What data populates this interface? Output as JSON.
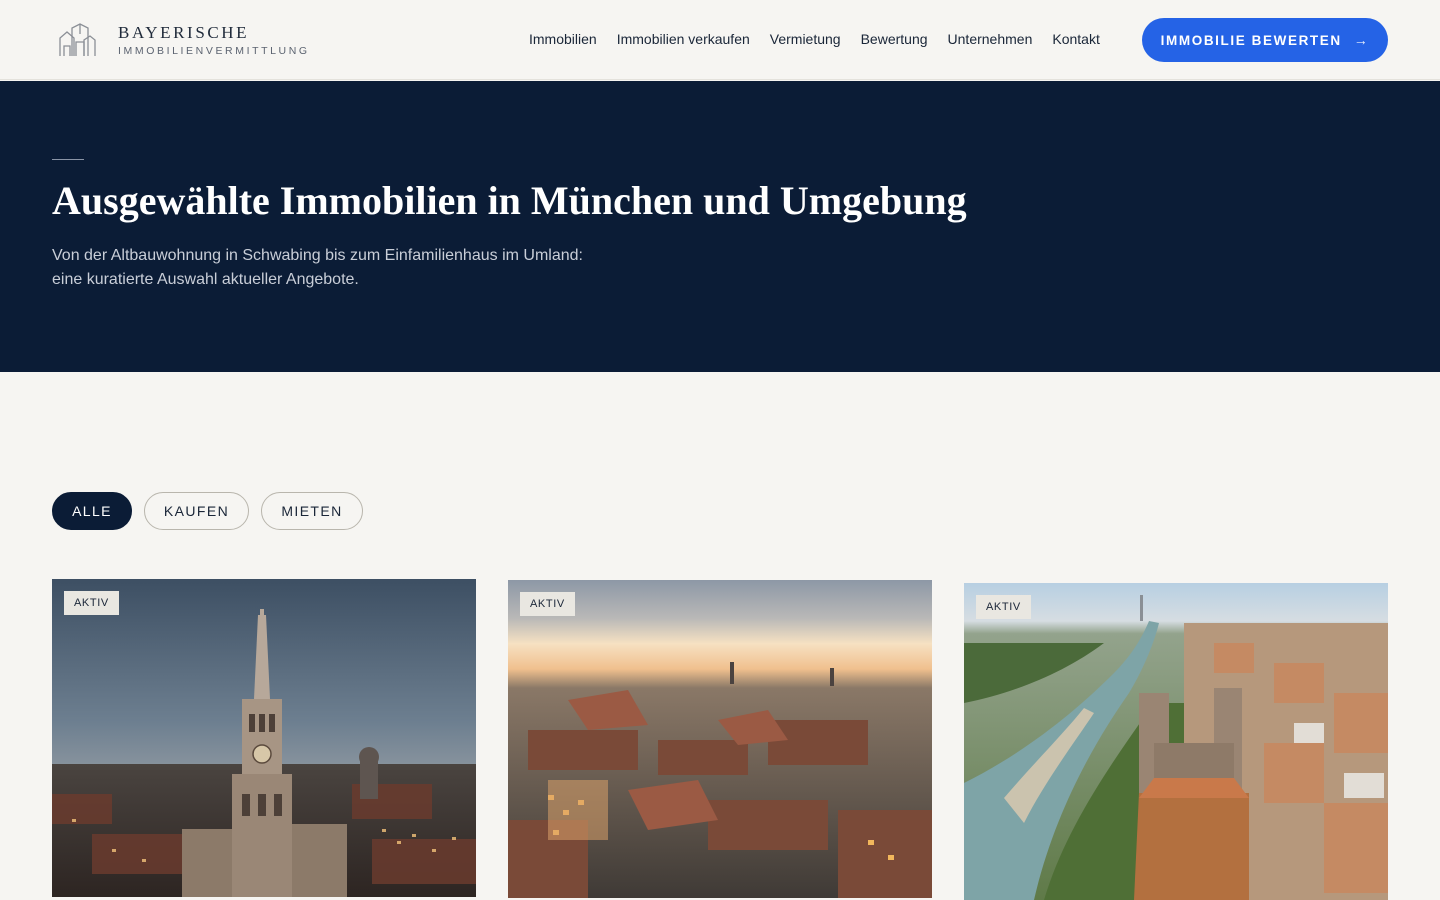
{
  "brand": {
    "title": "BAYERISCHE",
    "subtitle": "IMMOBILIENVERMITTLUNG",
    "colors": {
      "navy": "#0b1c36",
      "accent": "#2563e6",
      "background": "#f6f5f2"
    }
  },
  "nav": {
    "items": [
      {
        "label": "Immobilien"
      },
      {
        "label": "Immobilien verkaufen"
      },
      {
        "label": "Vermietung"
      },
      {
        "label": "Bewertung"
      },
      {
        "label": "Unternehmen"
      },
      {
        "label": "Kontakt"
      }
    ],
    "cta_label": "IMMOBILIE BEWERTEN",
    "cta_icon": "arrow-right-icon"
  },
  "hero": {
    "title": "Ausgewählte Immobilien in München und Umgebung",
    "text_line1": "Von der Altbauwohnung in Schwabing bis zum Einfamilienhaus im Umland:",
    "text_line2": "eine kuratierte Auswahl aktueller Angebote."
  },
  "filters": {
    "items": [
      {
        "label": "ALLE",
        "active": true
      },
      {
        "label": "KAUFEN",
        "active": false
      },
      {
        "label": "MIETEN",
        "active": false
      }
    ]
  },
  "listings": [
    {
      "status": "AKTIV"
    },
    {
      "status": "AKTIV"
    },
    {
      "status": "AKTIV"
    }
  ]
}
